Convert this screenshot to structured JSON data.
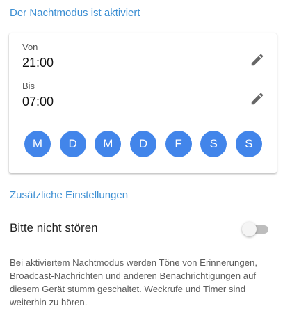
{
  "night_mode_header": "Der Nachtmodus ist aktiviert",
  "schedule": {
    "from_label": "Von",
    "from_time": "21:00",
    "to_label": "Bis",
    "to_time": "07:00",
    "days": [
      "M",
      "D",
      "M",
      "D",
      "F",
      "S",
      "S"
    ],
    "edit_icon": "pencil-icon"
  },
  "additional_settings_header": "Zusätzliche Einstellungen",
  "do_not_disturb": {
    "label": "Bitte nicht stören",
    "enabled": false
  },
  "description": "Bei aktiviertem Nachtmodus werden Töne von Erinnerungen, Broadcast-Nachrichten und anderen Benachrichtigungen auf diesem Gerät stumm geschaltet. Weckrufe und Timer sind weiterhin zu hören.",
  "colors": {
    "accent_text": "#3d8fd3",
    "day_circle": "#4285ea",
    "switch_track_off": "#bdbdbd"
  }
}
